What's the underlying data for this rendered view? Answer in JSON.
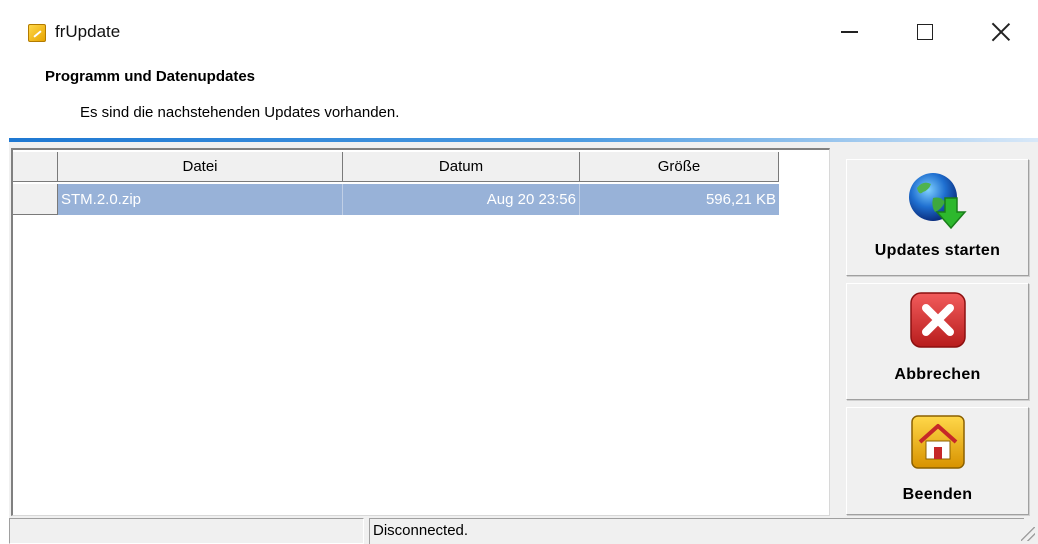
{
  "window": {
    "title": "frUpdate",
    "controls": {
      "minimize": "minimize-icon",
      "maximize": "maximize-icon",
      "close": "close-icon"
    }
  },
  "header": {
    "title": "Programm und Datenupdates",
    "subtitle": "Es sind die nachstehenden Updates vorhanden."
  },
  "grid": {
    "columns": [
      "Datei",
      "Datum",
      "Größe"
    ],
    "rows": [
      {
        "file": "STM.2.0.zip",
        "date": "Aug 20 23:56",
        "size": "596,21 KB",
        "selected": true
      }
    ],
    "selection_color": "#98b2d8"
  },
  "actions": {
    "start": {
      "label": "Updates starten",
      "icon": "globe-download-icon"
    },
    "cancel": {
      "label": "Abbrechen",
      "icon": "red-x-icon"
    },
    "quit": {
      "label": "Beenden",
      "icon": "home-icon"
    }
  },
  "status": {
    "text": "Disconnected."
  },
  "colors": {
    "accent_line": "#1e78d2",
    "cancel_red": "#d32f2f",
    "home_gold": "#e7a400"
  }
}
